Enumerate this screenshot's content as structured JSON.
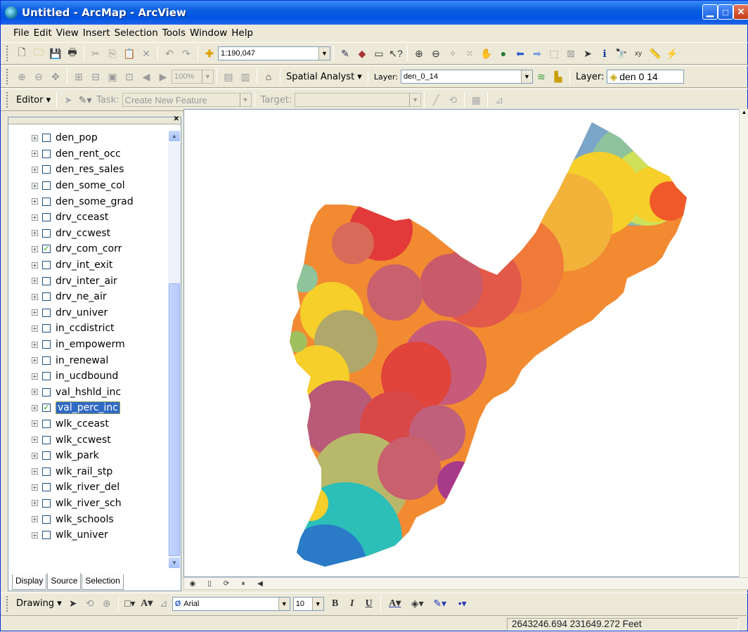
{
  "window": {
    "title": "Untitled - ArcMap - ArcView"
  },
  "menu": [
    "File",
    "Edit",
    "View",
    "Insert",
    "Selection",
    "Tools",
    "Window",
    "Help"
  ],
  "standard": {
    "scale": "1:190,047"
  },
  "spatial": {
    "analyst_label": "Spatial Analyst ▾",
    "layer_label": "Layer:",
    "layer_value": "den_0_14",
    "layer2_label": "Layer:",
    "layer2_value": "den 0 14",
    "zoom_value": "100%"
  },
  "editor": {
    "editor_label": "Editor ▾",
    "task_label": "Task:",
    "task_value": "Create New Feature",
    "target_label": "Target:"
  },
  "toc": {
    "layers": [
      {
        "name": "den_pop",
        "checked": false
      },
      {
        "name": "den_rent_occ",
        "checked": false
      },
      {
        "name": "den_res_sales",
        "checked": false
      },
      {
        "name": "den_some_col",
        "checked": false
      },
      {
        "name": "den_some_grad",
        "checked": false
      },
      {
        "name": "drv_cceast",
        "checked": false
      },
      {
        "name": "drv_ccwest",
        "checked": false
      },
      {
        "name": "drv_com_corr",
        "checked": true
      },
      {
        "name": "drv_int_exit",
        "checked": false
      },
      {
        "name": "drv_inter_air",
        "checked": false
      },
      {
        "name": "drv_ne_air",
        "checked": false
      },
      {
        "name": "drv_univer",
        "checked": false
      },
      {
        "name": "in_ccdistrict",
        "checked": false
      },
      {
        "name": "in_empowerm",
        "checked": false
      },
      {
        "name": "in_renewal",
        "checked": false
      },
      {
        "name": "in_ucdbound",
        "checked": false
      },
      {
        "name": "val_hshld_inc",
        "checked": false
      },
      {
        "name": "val_perc_inc",
        "checked": true,
        "selected": true
      },
      {
        "name": "wlk_cceast",
        "checked": false
      },
      {
        "name": "wlk_ccwest",
        "checked": false
      },
      {
        "name": "wlk_park",
        "checked": false
      },
      {
        "name": "wlk_rail_stp",
        "checked": false
      },
      {
        "name": "wlk_river_del",
        "checked": false
      },
      {
        "name": "wlk_river_sch",
        "checked": false
      },
      {
        "name": "wlk_schools",
        "checked": false
      },
      {
        "name": "wlk_univer",
        "checked": false
      }
    ],
    "tabs": [
      "Display",
      "Source",
      "Selection"
    ]
  },
  "drawing": {
    "drawing_label": "Drawing ▾",
    "font": "Arial",
    "font_size": "10",
    "bold": "B",
    "italic": "I",
    "underline": "U"
  },
  "status": {
    "coords": "2643246.694  231649.272 Feet"
  },
  "colors": {
    "title_bar": "#0054e3",
    "selection": "#316ac5"
  }
}
